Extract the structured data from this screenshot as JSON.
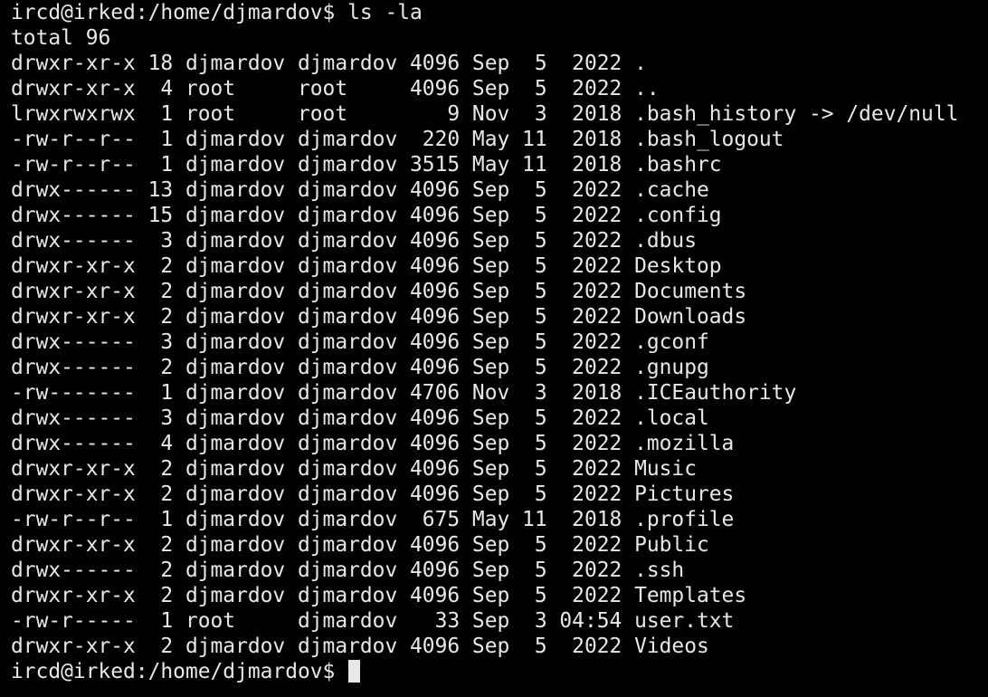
{
  "terminal": {
    "prompt": "ircd@irked:/home/djmardov$ ",
    "command": "ls -la",
    "output": [
      "total 96",
      "drwxr-xr-x 18 djmardov djmardov 4096 Sep  5  2022 .",
      "drwxr-xr-x  4 root     root     4096 Sep  5  2022 ..",
      "lrwxrwxrwx  1 root     root        9 Nov  3  2018 .bash_history -> /dev/null",
      "-rw-r--r--  1 djmardov djmardov  220 May 11  2018 .bash_logout",
      "-rw-r--r--  1 djmardov djmardov 3515 May 11  2018 .bashrc",
      "drwx------ 13 djmardov djmardov 4096 Sep  5  2022 .cache",
      "drwx------ 15 djmardov djmardov 4096 Sep  5  2022 .config",
      "drwx------  3 djmardov djmardov 4096 Sep  5  2022 .dbus",
      "drwxr-xr-x  2 djmardov djmardov 4096 Sep  5  2022 Desktop",
      "drwxr-xr-x  2 djmardov djmardov 4096 Sep  5  2022 Documents",
      "drwxr-xr-x  2 djmardov djmardov 4096 Sep  5  2022 Downloads",
      "drwx------  3 djmardov djmardov 4096 Sep  5  2022 .gconf",
      "drwx------  2 djmardov djmardov 4096 Sep  5  2022 .gnupg",
      "-rw-------  1 djmardov djmardov 4706 Nov  3  2018 .ICEauthority",
      "drwx------  3 djmardov djmardov 4096 Sep  5  2022 .local",
      "drwx------  4 djmardov djmardov 4096 Sep  5  2022 .mozilla",
      "drwxr-xr-x  2 djmardov djmardov 4096 Sep  5  2022 Music",
      "drwxr-xr-x  2 djmardov djmardov 4096 Sep  5  2022 Pictures",
      "-rw-r--r--  1 djmardov djmardov  675 May 11  2018 .profile",
      "drwxr-xr-x  2 djmardov djmardov 4096 Sep  5  2022 Public",
      "drwx------  2 djmardov djmardov 4096 Sep  5  2022 .ssh",
      "drwxr-xr-x  2 djmardov djmardov 4096 Sep  5  2022 Templates",
      "-rw-r-----  1 root     djmardov   33 Sep  3 04:54 user.txt",
      "drwxr-xr-x  2 djmardov djmardov 4096 Sep  5  2022 Videos"
    ],
    "final_prompt": "ircd@irked:/home/djmardov$ ",
    "colors": {
      "background": "#000000",
      "foreground": "#e8e8e8"
    }
  }
}
